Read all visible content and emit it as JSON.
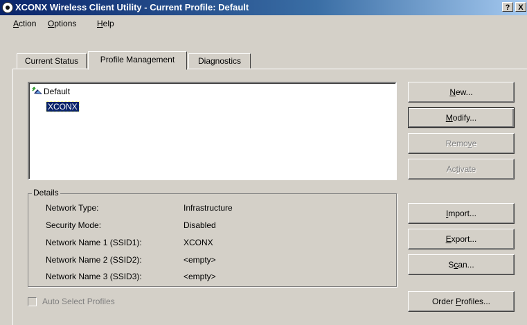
{
  "window": {
    "title": "XCONX Wireless Client Utility - Current Profile: Default",
    "help_button": "?",
    "close_button": "X"
  },
  "menu": [
    {
      "pre": "",
      "acc": "A",
      "post": "ction"
    },
    {
      "pre": "",
      "acc": "O",
      "post": "ptions"
    },
    {
      "pre": "",
      "acc": "H",
      "post": "elp"
    }
  ],
  "tabs": [
    "Current Status",
    "Profile Management",
    "Diagnostics"
  ],
  "active_tab": "Profile Management",
  "profiles": [
    {
      "name": "Default",
      "active": true,
      "selected": false
    },
    {
      "name": "XCONX",
      "active": false,
      "selected": true
    }
  ],
  "details": {
    "legend": "Details",
    "rows": [
      {
        "label": "Network Type:",
        "value": "Infrastructure"
      },
      {
        "label": "Security Mode:",
        "value": "Disabled"
      },
      {
        "label": "Network Name 1 (SSID1):",
        "value": "XCONX"
      },
      {
        "label": "Network Name 2 (SSID2):",
        "value": "<empty>"
      },
      {
        "label": "Network Name 3 (SSID3):",
        "value": "<empty>"
      }
    ]
  },
  "auto_select": {
    "label": "Auto Select Profiles",
    "checked": false,
    "enabled": false
  },
  "buttons": {
    "new": {
      "pre": "",
      "acc": "N",
      "post": "ew..."
    },
    "modify": {
      "pre": "",
      "acc": "M",
      "post": "odify..."
    },
    "remove": {
      "pre": "Remo",
      "acc": "v",
      "post": "e"
    },
    "activate": {
      "pre": "Ac",
      "acc": "t",
      "post": "ivate"
    },
    "import": {
      "pre": "",
      "acc": "I",
      "post": "mport..."
    },
    "export": {
      "pre": "",
      "acc": "E",
      "post": "xport..."
    },
    "scan": {
      "pre": "S",
      "acc": "c",
      "post": "an..."
    },
    "order": {
      "pre": "Order ",
      "acc": "P",
      "post": "rofiles..."
    }
  },
  "colors": {
    "title_start": "#0a246a",
    "title_end": "#a6caf0",
    "face": "#d4d0c8",
    "selection": "#0a246a"
  }
}
